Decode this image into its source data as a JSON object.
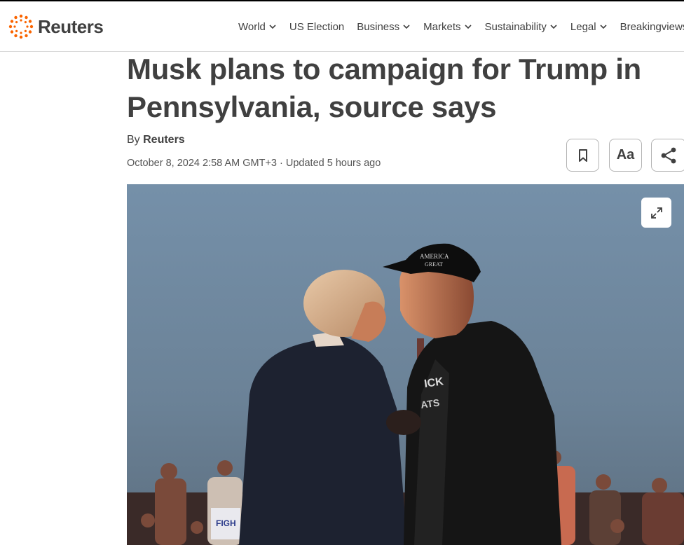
{
  "header": {
    "logo_text": "Reuters",
    "nav": [
      {
        "label": "World",
        "has_dropdown": true
      },
      {
        "label": "US Election",
        "has_dropdown": false
      },
      {
        "label": "Business",
        "has_dropdown": true
      },
      {
        "label": "Markets",
        "has_dropdown": true
      },
      {
        "label": "Sustainability",
        "has_dropdown": true
      },
      {
        "label": "Legal",
        "has_dropdown": true
      },
      {
        "label": "Breakingviews",
        "has_dropdown": false
      }
    ]
  },
  "article": {
    "headline": "Musk plans to campaign for Trump in Pennsylvania, source says",
    "byline_prefix": "By",
    "byline_author": "Reuters",
    "dateline": "October 8, 2024 2:58 AM GMT+3 · Updated 5 hours ago",
    "tools": {
      "bookmark_icon": "bookmark-icon",
      "text_size_label": "Aa",
      "share_icon": "share-icon"
    },
    "photo": {
      "expand_icon": "expand-icon",
      "sign_text": "FIGH",
      "cap_text": "AMERICA",
      "cap_text2": "GREAT"
    }
  },
  "colors": {
    "brand_orange": "#fa6400",
    "text": "#404040",
    "sky": "#6f8aa4"
  }
}
